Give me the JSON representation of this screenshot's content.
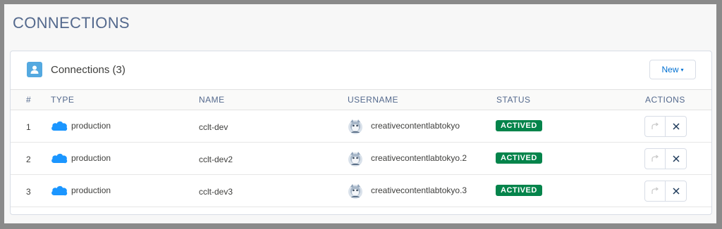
{
  "page": {
    "title": "CONNECTIONS"
  },
  "card": {
    "title": "Connections (3)",
    "icon": "user-icon",
    "new_button": {
      "label": "New",
      "caret": "▾"
    }
  },
  "table": {
    "headers": {
      "num": "#",
      "type": "TYPE",
      "name": "NAME",
      "username": "USERNAME",
      "status": "STATUS",
      "actions": "ACTIONS"
    },
    "rows": [
      {
        "num": "1",
        "type": "production",
        "name": "cclt-dev",
        "username": "creativecontentlabtokyo",
        "status": "ACTIVED"
      },
      {
        "num": "2",
        "type": "production",
        "name": "cclt-dev2",
        "username": "creativecontentlabtokyo.2",
        "status": "ACTIVED"
      },
      {
        "num": "3",
        "type": "production",
        "name": "cclt-dev3",
        "username": "creativecontentlabtokyo.3",
        "status": "ACTIVED"
      }
    ]
  },
  "colors": {
    "accent": "#0070d2",
    "status_active": "#04844b",
    "title": "#54698d",
    "card_icon": "#54a9e0",
    "cloud": "#1b96ff"
  }
}
